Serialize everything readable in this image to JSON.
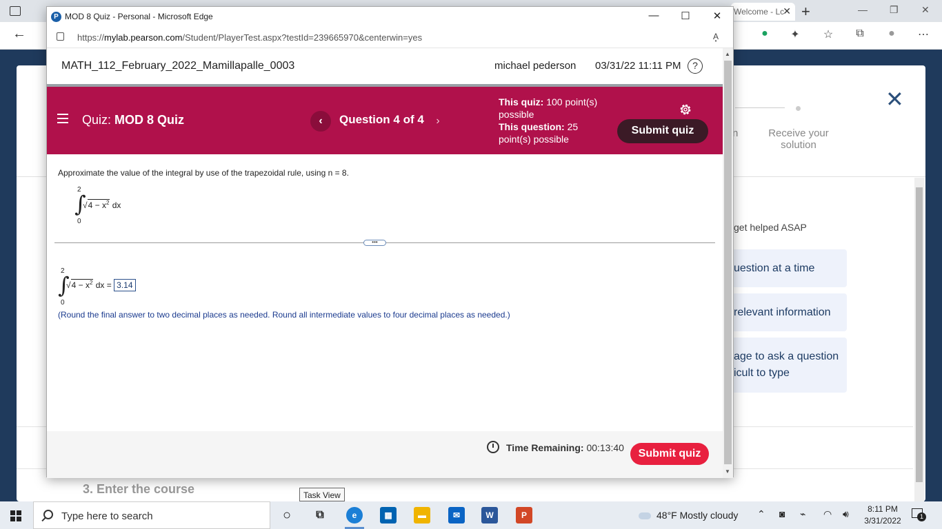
{
  "background": {
    "tab_title": "Welcome - Lc",
    "step_receive_label": "Receive your solution",
    "step_prev_fragment": "n",
    "help_title": "get helped ASAP",
    "help_items": [
      "uestion at a time",
      "relevant information",
      "age to ask a question",
      "icult to type"
    ],
    "step3_label": "3. Enter the course"
  },
  "popup": {
    "title": "MOD 8 Quiz - Personal - Microsoft Edge",
    "logo_letter": "P",
    "url_prefix": "https://",
    "url_domain": "mylab.pearson.com",
    "url_path": "/Student/PlayerTest.aspx?testId=239665970&centerwin=yes",
    "read_aloud": "A͓"
  },
  "course": {
    "name": "MATH_112_February_2022_Mamillapalle_0003",
    "user": "michael pederson",
    "datetime": "03/31/22 11:11 PM",
    "help": "?"
  },
  "quiz_bar": {
    "quiz_prefix": "Quiz:",
    "quiz_name": "MOD 8 Quiz",
    "prev": "‹",
    "question": "Question 4 of 4",
    "next": "›",
    "quiz_points_label": "This quiz:",
    "quiz_points_value": "100 point(s) possible",
    "question_points_label": "This question:",
    "question_points_value": "25 point(s) possible",
    "submit_label": "Submit quiz"
  },
  "problem": {
    "text": "Approximate the value of the integral by use of the trapezoidal rule, using n = 8.",
    "integral_upper": "2",
    "integral_lower": "0",
    "integral_sign": "∫",
    "radicand_base": "4 − x",
    "radicand_exp": "2",
    "differential": "dx",
    "radical_sign": "√",
    "expand": "•••",
    "answer_equals": "=",
    "answer_value": "3.14",
    "round_note": "(Round the final answer to two decimal places as needed. Round all intermediate values to four decimal places as needed.)"
  },
  "bottom": {
    "time_label": "Time Remaining:",
    "time_value": "00:13:40",
    "submit_label": "Submit quiz"
  },
  "tooltip": "Task View",
  "taskbar": {
    "search_placeholder": "Type here to search",
    "weather": "48°F  Mostly cloudy",
    "time": "8:11 PM",
    "date": "3/31/2022",
    "notification_count": "1",
    "apps": [
      {
        "name": "word",
        "letter": "W",
        "color": "#2b579a"
      },
      {
        "name": "powerpoint",
        "letter": "P",
        "color": "#d24726"
      }
    ]
  },
  "colors": {
    "quiz_bar": "#b0114b",
    "submit_bottom": "#e8203f",
    "submit_top": "#3b1a26"
  }
}
